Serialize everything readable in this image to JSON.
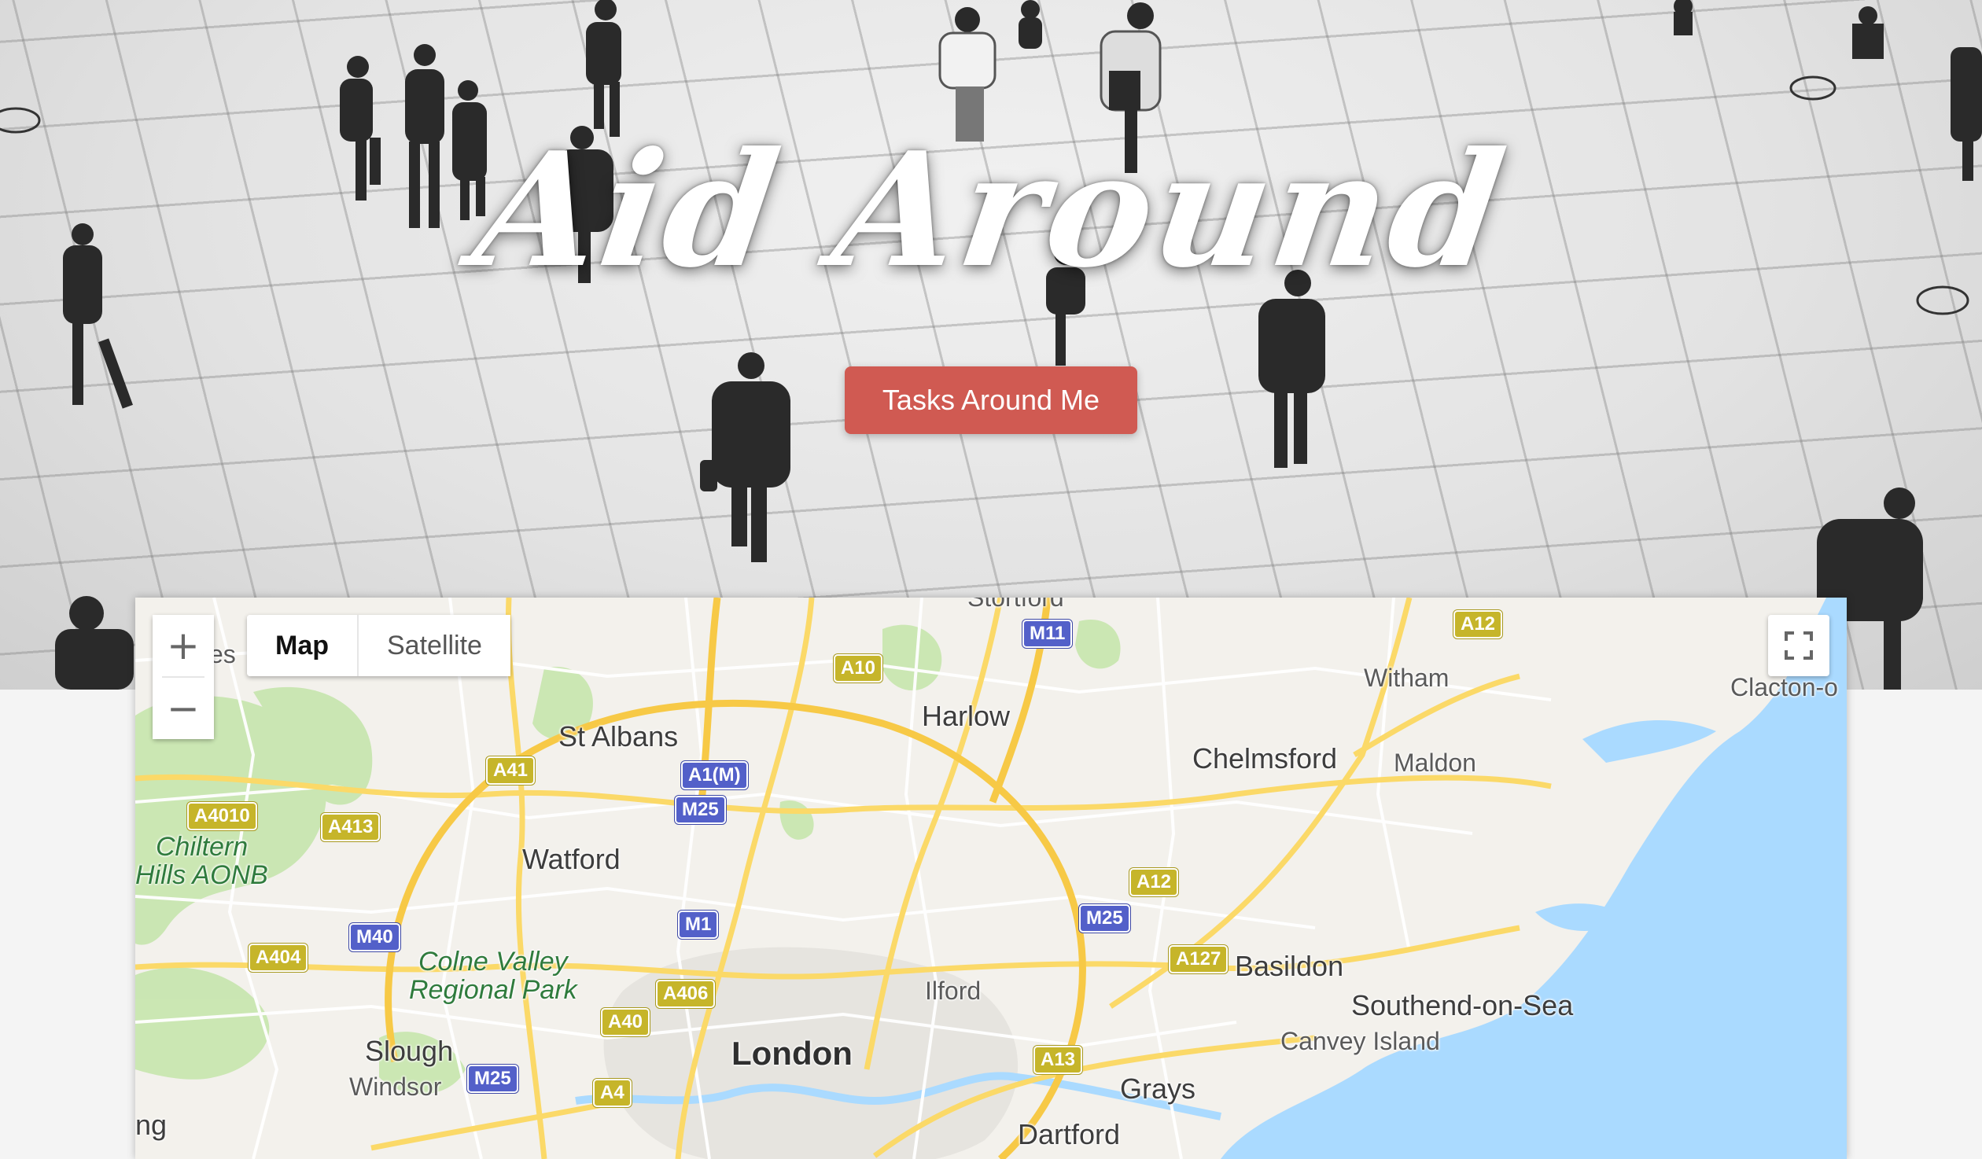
{
  "hero": {
    "title": "Aid Around",
    "cta_label": "Tasks Around Me"
  },
  "map": {
    "controls": {
      "zoom_in": "+",
      "zoom_out": "−",
      "map_type_map": "Map",
      "map_type_satellite": "Satellite",
      "fullscreen_icon": "fullscreen-icon"
    },
    "places": {
      "stortford": "Stortford",
      "harlow": "Harlow",
      "witham": "Witham",
      "clacton": "Clacton-o",
      "es": "es",
      "st_albans": "St Albans",
      "chelmsford": "Chelmsford",
      "maldon": "Maldon",
      "chiltern": "Chiltern",
      "hills_aonb": "Hills AONB",
      "watford": "Watford",
      "colne_valley": "Colne Valley",
      "regional_park": "Regional Park",
      "basildon": "Basildon",
      "ilford": "Ilford",
      "southend": "Southend-on-Sea",
      "canvey": "Canvey Island",
      "slough": "Slough",
      "london": "London",
      "windsor": "Windsor",
      "grays": "Grays",
      "dartford": "Dartford",
      "ng": "ng"
    },
    "roads": {
      "m11": "M11",
      "a10": "A10",
      "a12_top": "A12",
      "a41": "A41",
      "a1m": "A1(M)",
      "m25_north": "M25",
      "a4010": "A4010",
      "a413": "A413",
      "a12_mid": "A12",
      "m25_east": "M25",
      "m1": "M1",
      "m40": "M40",
      "a404": "A404",
      "a127": "A127",
      "a406": "A406",
      "a40": "A40",
      "a13": "A13",
      "m25_west": "M25",
      "a4": "A4"
    },
    "colors": {
      "land": "#f3f1ec",
      "water": "#aadaff",
      "park": "#c8e6b0",
      "major_road": "#fbd968",
      "minor_road": "#ffffff"
    }
  },
  "colors": {
    "cta_background": "#d05a52",
    "hero_tile": "#e3e3e3"
  }
}
